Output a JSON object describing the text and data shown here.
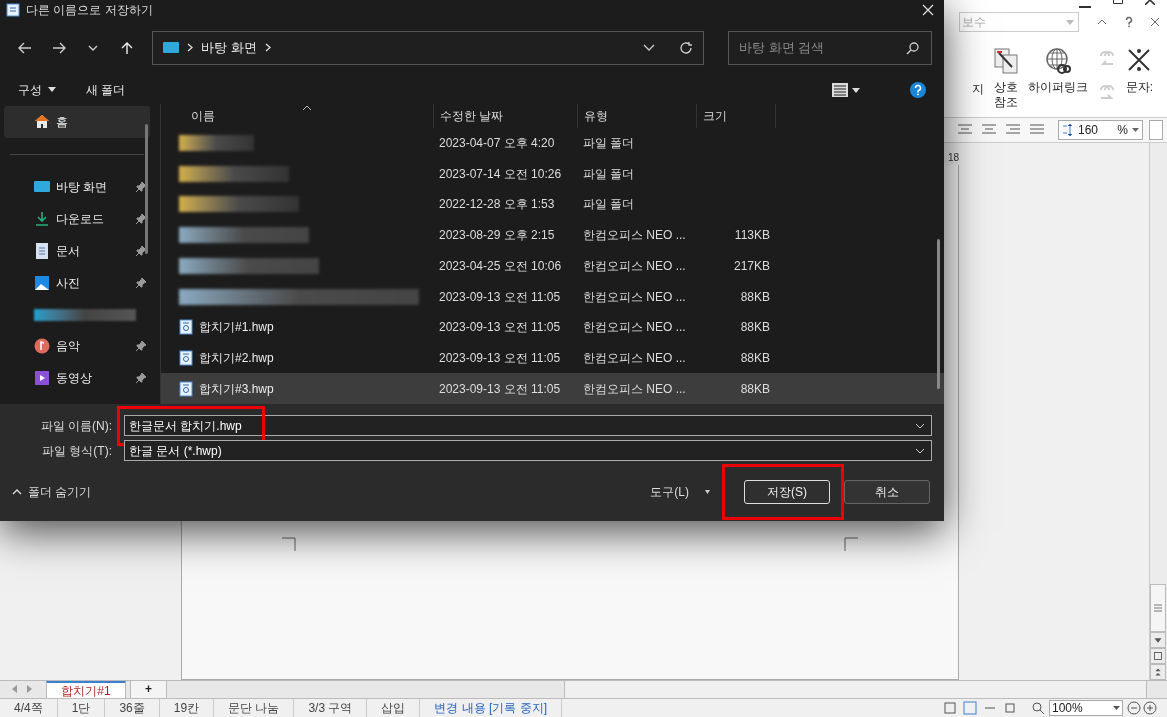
{
  "app": {
    "style_box": "보수",
    "ribbon": [
      {
        "kind": "cut",
        "label": "지"
      },
      {
        "kind": "crossref",
        "label": "상호\n참조"
      },
      {
        "kind": "hyperlink",
        "label": "하이퍼링크"
      },
      {
        "kind": "char",
        "label": "문자:"
      }
    ],
    "line_spacing": "160",
    "line_spacing_unit": "%",
    "ruler_mark": "18",
    "doc_tabs": [
      {
        "label": "합치기#1",
        "selected": true
      },
      {
        "label": "+",
        "selected": false
      }
    ],
    "status_bar": [
      {
        "text": "4/4쪽",
        "kind": "plain"
      },
      {
        "text": "1단",
        "kind": "plain"
      },
      {
        "text": "36줄",
        "kind": "plain"
      },
      {
        "text": "19칸",
        "kind": "plain"
      },
      {
        "text": "문단 나눔",
        "kind": "plain"
      },
      {
        "text": "3/3 구역",
        "kind": "plain"
      },
      {
        "text": "삽입",
        "kind": "plain"
      },
      {
        "text": "변경 내용 [기록 중지]",
        "kind": "link"
      }
    ],
    "zoom": "100%"
  },
  "dialog": {
    "title": "다른 이름으로 저장하기",
    "path": "바탕 화면",
    "search": {
      "placeholder": "바탕 화면 검색"
    },
    "toolbar": {
      "organize": "구성",
      "new_folder": "새 폴더"
    },
    "sidebar": [
      {
        "kind": "home",
        "label": "홈",
        "pinned": false,
        "selected": true
      },
      {
        "kind": "desktop",
        "label": "바탕 화면",
        "pinned": true,
        "selected": false
      },
      {
        "kind": "download",
        "label": "다운로드",
        "pinned": true,
        "selected": false
      },
      {
        "kind": "document",
        "label": "문서",
        "pinned": true,
        "selected": false
      },
      {
        "kind": "picture",
        "label": "사진",
        "pinned": true,
        "selected": false
      },
      {
        "kind": "redacted",
        "selected": false
      },
      {
        "kind": "music",
        "label": "음악",
        "pinned": true,
        "selected": false
      },
      {
        "kind": "video",
        "label": "동영상",
        "pinned": true,
        "selected": false
      }
    ],
    "columns": [
      "이름",
      "수정한 날짜",
      "유형",
      "크기"
    ],
    "rows": [
      {
        "kind": "hidden-folder",
        "date": "2023-04-07 오후 4:20",
        "type": "파일 폴더",
        "selected": false
      },
      {
        "kind": "hidden-folder",
        "date": "2023-07-14 오전 10:26",
        "type": "파일 폴더",
        "selected": false
      },
      {
        "kind": "hidden-folder",
        "date": "2022-12-28 오후 1:53",
        "type": "파일 폴더",
        "selected": false
      },
      {
        "kind": "hidden-file",
        "date": "2023-08-29 오후 2:15",
        "type": "한컴오피스 NEO ...",
        "size": "113KB",
        "selected": false
      },
      {
        "kind": "hidden-file",
        "date": "2023-04-25 오전 10:06",
        "type": "한컴오피스 NEO ...",
        "size": "217KB",
        "selected": false
      },
      {
        "kind": "hidden-file",
        "date": "2023-09-13 오전 11:05",
        "type": "한컴오피스 NEO ...",
        "size": "88KB",
        "selected": false
      },
      {
        "kind": "file",
        "name": "합치기#1.hwp",
        "date": "2023-09-13 오전 11:05",
        "type": "한컴오피스 NEO ...",
        "size": "88KB",
        "selected": false
      },
      {
        "kind": "file",
        "name": "합치기#2.hwp",
        "date": "2023-09-13 오전 11:05",
        "type": "한컴오피스 NEO ...",
        "size": "88KB",
        "selected": false
      },
      {
        "kind": "file",
        "name": "합치기#3.hwp",
        "date": "2023-09-13 오전 11:05",
        "type": "한컴오피스 NEO ...",
        "size": "88KB",
        "selected": true
      }
    ],
    "filename": {
      "label": "파일 이름(N):",
      "value": "한글문서 합치기.hwp",
      "highlighted": true
    },
    "filetype": {
      "label": "파일 형식(T):",
      "value": "한글 문서 (*.hwp)"
    },
    "hide_folders": "폴더 숨기기",
    "tools": "도구(L)",
    "buttons": [
      {
        "label": "저장(S)",
        "kind": "primary",
        "highlighted": true
      },
      {
        "label": "취소",
        "kind": "normal",
        "highlighted": false
      }
    ]
  }
}
